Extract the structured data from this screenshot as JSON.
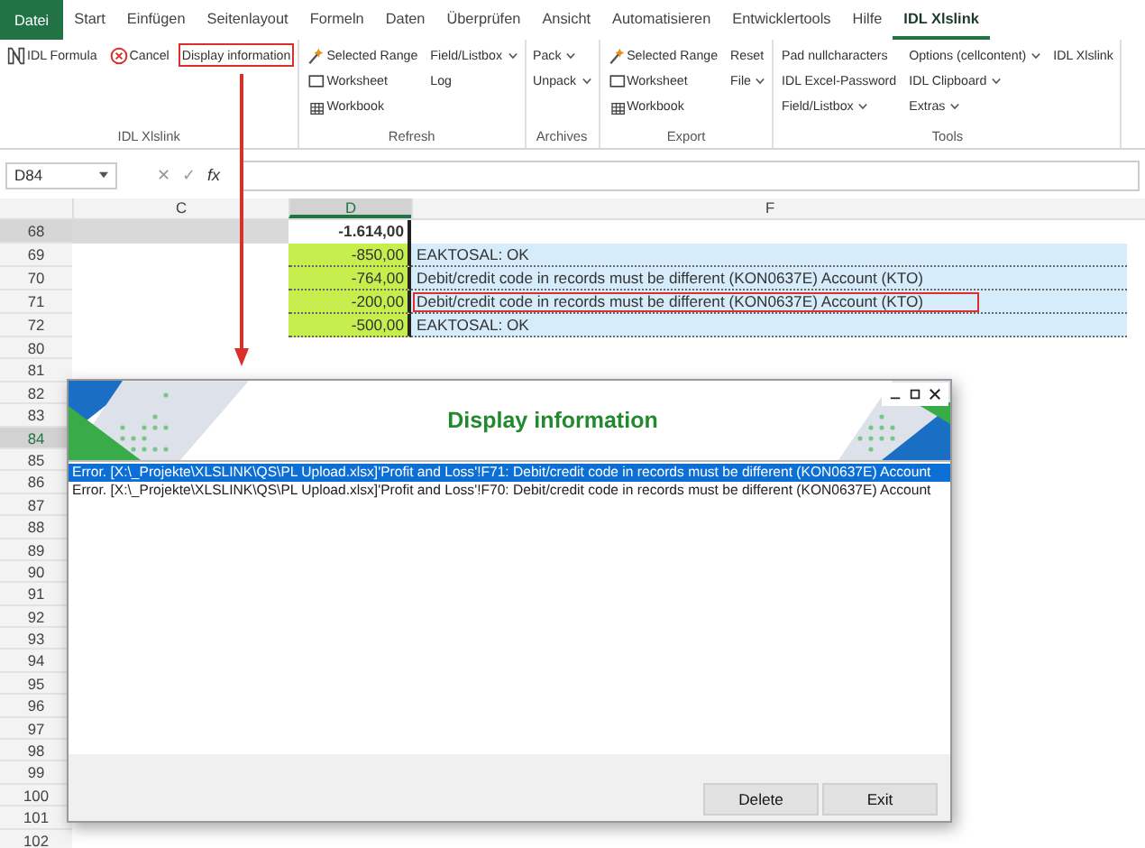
{
  "ribbon": {
    "file_tab": "Datei",
    "tabs": [
      {
        "label": "Start",
        "selected": false
      },
      {
        "label": "Einfügen",
        "selected": false
      },
      {
        "label": "Seitenlayout",
        "selected": false
      },
      {
        "label": "Formeln",
        "selected": false
      },
      {
        "label": "Daten",
        "selected": false
      },
      {
        "label": "Überprüfen",
        "selected": false
      },
      {
        "label": "Ansicht",
        "selected": false
      },
      {
        "label": "Automatisieren",
        "selected": false
      },
      {
        "label": "Entwicklertools",
        "selected": false
      },
      {
        "label": "Hilfe",
        "selected": false
      },
      {
        "label": "IDL Xlslink",
        "selected": true
      }
    ],
    "groups": [
      {
        "label": "IDL Xlslink",
        "columns": [
          [
            {
              "label": "IDL Formula",
              "kind": "formula",
              "dropdown": false,
              "highlighted": false
            }
          ],
          [
            {
              "label": "Cancel",
              "kind": "cancel",
              "dropdown": false,
              "highlighted": false
            }
          ],
          [
            {
              "label": "Display information",
              "kind": "plain",
              "dropdown": false,
              "highlighted": true
            }
          ]
        ]
      },
      {
        "label": "Refresh",
        "columns": [
          [
            {
              "label": "Selected Range",
              "kind": "range",
              "dropdown": false,
              "highlighted": false
            },
            {
              "label": "Worksheet",
              "kind": "worksheet",
              "dropdown": false,
              "highlighted": false
            },
            {
              "label": "Workbook",
              "kind": "workbook",
              "dropdown": false,
              "highlighted": false
            }
          ],
          [
            {
              "label": "Field/Listbox",
              "kind": "plain",
              "dropdown": true,
              "highlighted": false
            },
            {
              "label": "Log",
              "kind": "plain",
              "dropdown": false,
              "highlighted": false
            }
          ]
        ]
      },
      {
        "label": "Archives",
        "columns": [
          [
            {
              "label": "Pack",
              "kind": "plain",
              "dropdown": true,
              "highlighted": false
            },
            {
              "label": "Unpack",
              "kind": "plain",
              "dropdown": true,
              "highlighted": false
            }
          ]
        ]
      },
      {
        "label": "Export",
        "columns": [
          [
            {
              "label": "Selected Range",
              "kind": "range",
              "dropdown": false,
              "highlighted": false
            },
            {
              "label": "Worksheet",
              "kind": "worksheet",
              "dropdown": false,
              "highlighted": false
            },
            {
              "label": "Workbook",
              "kind": "workbook",
              "dropdown": false,
              "highlighted": false
            }
          ],
          [
            {
              "label": "Reset",
              "kind": "plain",
              "dropdown": false,
              "highlighted": false
            },
            {
              "label": "File",
              "kind": "plain",
              "dropdown": true,
              "highlighted": false
            }
          ]
        ]
      },
      {
        "label": "Tools",
        "columns": [
          [
            {
              "label": "Pad nullcharacters",
              "kind": "plain",
              "dropdown": false,
              "highlighted": false
            },
            {
              "label": "IDL Excel-Password",
              "kind": "plain",
              "dropdown": false,
              "highlighted": false
            },
            {
              "label": "Field/Listbox",
              "kind": "plain",
              "dropdown": true,
              "highlighted": false
            }
          ],
          [
            {
              "label": "Options (cellcontent)",
              "kind": "plain",
              "dropdown": true,
              "highlighted": false
            },
            {
              "label": "IDL Clipboard",
              "kind": "plain",
              "dropdown": true,
              "highlighted": false
            },
            {
              "label": "Extras",
              "kind": "plain",
              "dropdown": true,
              "highlighted": false
            }
          ],
          [
            {
              "label": "IDL Xlslink",
              "kind": "plain",
              "dropdown": false,
              "highlighted": false
            }
          ]
        ]
      }
    ]
  },
  "formula_bar": {
    "name_box": "D84",
    "cancel": "✕",
    "enter": "✓",
    "function": "fx"
  },
  "sheet": {
    "columns": [
      {
        "label": "C",
        "selected": false
      },
      {
        "label": "D",
        "selected": true
      },
      {
        "label": "F",
        "selected": false
      }
    ],
    "rows": [
      {
        "number": "68",
        "selected": false,
        "shaded": true,
        "marked": false,
        "d": "-1.614,00"
      },
      {
        "number": "69",
        "selected": false,
        "shaded": false,
        "marked": true,
        "flagged": false,
        "d": "-850,00",
        "f": "EAKTOSAL: OK"
      },
      {
        "number": "70",
        "selected": false,
        "shaded": false,
        "marked": true,
        "flagged": false,
        "d": "-764,00",
        "f": "Debit/credit code in records must be different (KON0637E) Account (KTO)"
      },
      {
        "number": "71",
        "selected": false,
        "shaded": false,
        "marked": true,
        "flagged": true,
        "d": "-200,00",
        "f": "Debit/credit code in records must be different (KON0637E) Account (KTO)"
      },
      {
        "number": "72",
        "selected": false,
        "shaded": false,
        "marked": true,
        "flagged": false,
        "d": "-500,00",
        "f": "EAKTOSAL: OK"
      },
      {
        "number": "80",
        "selected": false
      },
      {
        "number": "81",
        "selected": false
      },
      {
        "number": "82",
        "selected": false
      },
      {
        "number": "83",
        "selected": false
      },
      {
        "number": "84",
        "selected": true
      },
      {
        "number": "85",
        "selected": false
      },
      {
        "number": "86",
        "selected": false
      },
      {
        "number": "87",
        "selected": false
      },
      {
        "number": "88",
        "selected": false
      },
      {
        "number": "89",
        "selected": false
      },
      {
        "number": "90",
        "selected": false
      },
      {
        "number": "91",
        "selected": false
      },
      {
        "number": "92",
        "selected": false
      },
      {
        "number": "93",
        "selected": false
      },
      {
        "number": "94",
        "selected": false
      },
      {
        "number": "95",
        "selected": false
      },
      {
        "number": "96",
        "selected": false
      },
      {
        "number": "97",
        "selected": false
      },
      {
        "number": "98",
        "selected": false
      },
      {
        "number": "99",
        "selected": false
      },
      {
        "number": "100",
        "selected": false
      },
      {
        "number": "101",
        "selected": false
      },
      {
        "number": "102",
        "selected": false
      }
    ]
  },
  "dialog": {
    "title": "Display information",
    "messages": [
      {
        "text": "Error. [X:\\_Projekte\\XLSLINK\\QS\\PL Upload.xlsx]'Profit and Loss'!F71: Debit/credit code in records must be different (KON0637E) Account",
        "selected": true
      },
      {
        "text": "Error. [X:\\_Projekte\\XLSLINK\\QS\\PL Upload.xlsx]'Profit and Loss'!F70: Debit/credit code in records must be different (KON0637E) Account",
        "selected": false
      }
    ],
    "buttons": [
      "Delete",
      "Exit"
    ]
  }
}
